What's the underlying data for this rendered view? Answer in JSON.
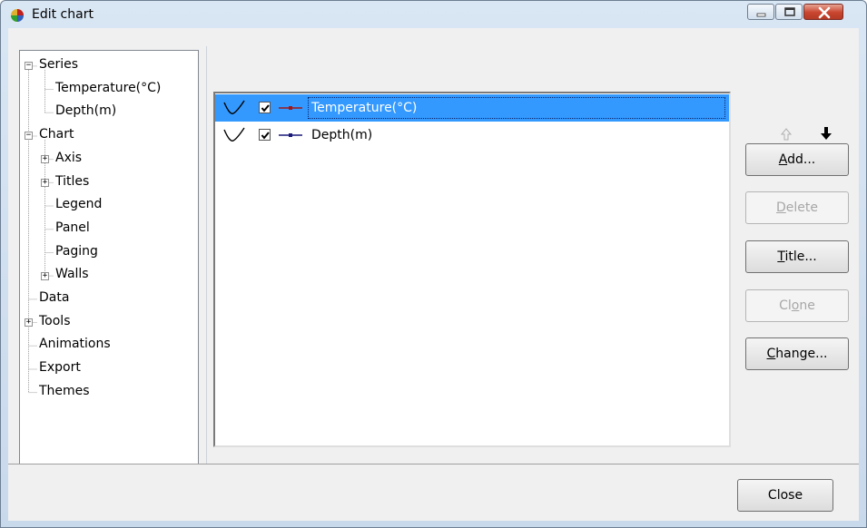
{
  "window": {
    "title": "Edit chart",
    "buttons": [
      "minimize",
      "maximize",
      "close"
    ]
  },
  "tree": [
    {
      "label": "Series",
      "level": 0,
      "expander": "−"
    },
    {
      "label": "Temperature(°C)",
      "level": 1,
      "expander": ""
    },
    {
      "label": "Depth(m)",
      "level": 1,
      "expander": ""
    },
    {
      "label": "Chart",
      "level": 0,
      "expander": "−"
    },
    {
      "label": "Axis",
      "level": 1,
      "expander": "+"
    },
    {
      "label": "Titles",
      "level": 1,
      "expander": "+"
    },
    {
      "label": "Legend",
      "level": 1,
      "expander": ""
    },
    {
      "label": "Panel",
      "level": 1,
      "expander": ""
    },
    {
      "label": "Paging",
      "level": 1,
      "expander": ""
    },
    {
      "label": "Walls",
      "level": 1,
      "expander": "+"
    },
    {
      "label": "Data",
      "level": 0,
      "expander": ""
    },
    {
      "label": "Tools",
      "level": 0,
      "expander": "+"
    },
    {
      "label": "Animations",
      "level": 0,
      "expander": ""
    },
    {
      "label": "Export",
      "level": 0,
      "expander": ""
    },
    {
      "label": "Themes",
      "level": 0,
      "expander": ""
    }
  ],
  "series_list": [
    {
      "label": "Temperature(°C)",
      "checked": true,
      "selected": true,
      "color": "#a01818"
    },
    {
      "label": "Depth(m)",
      "checked": true,
      "selected": false,
      "color": "#1a1a7a"
    }
  ],
  "buttons": {
    "add": {
      "pre": "",
      "ul": "A",
      "post": "dd..."
    },
    "delete": {
      "pre": "",
      "ul": "D",
      "post": "elete"
    },
    "title": {
      "pre": "",
      "ul": "T",
      "post": "itle..."
    },
    "clone": {
      "pre": "Cl",
      "ul": "o",
      "post": "ne"
    },
    "change": {
      "pre": "",
      "ul": "C",
      "post": "hange..."
    },
    "close": "Close"
  },
  "icons": {
    "move_up": "arrow-up-icon",
    "move_down": "arrow-down-icon",
    "gallery": "series-style-icon"
  }
}
